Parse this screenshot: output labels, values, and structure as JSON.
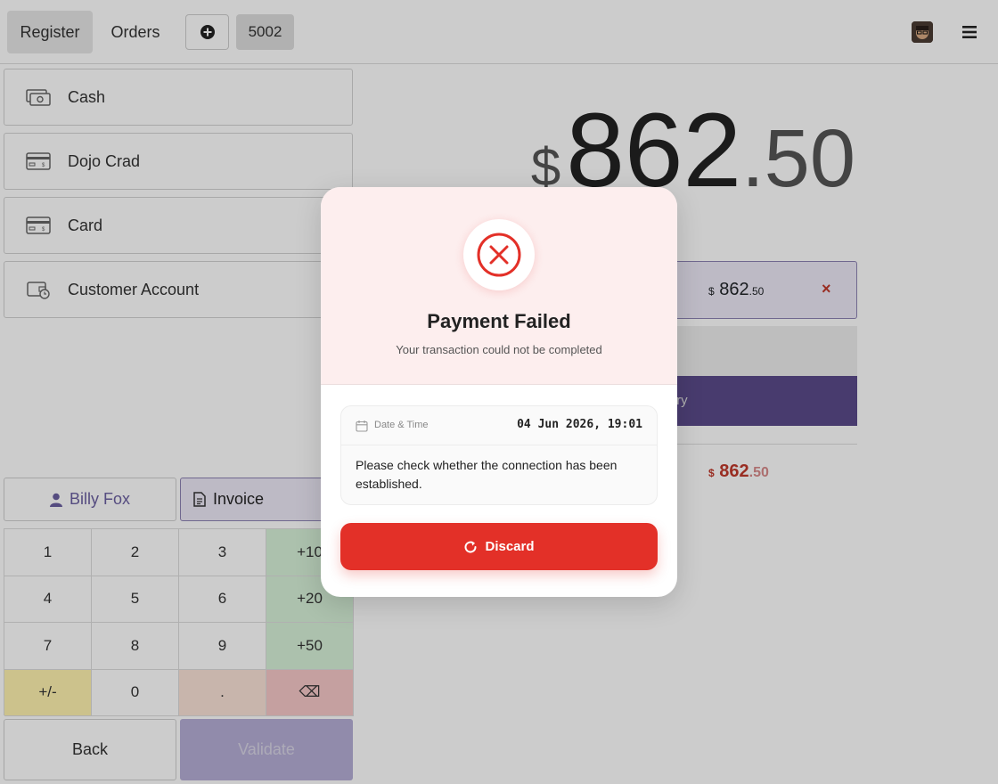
{
  "topbar": {
    "register_label": "Register",
    "orders_label": "Orders",
    "order_number": "5002"
  },
  "payment_methods": [
    {
      "label": "Cash",
      "icon": "cash-icon"
    },
    {
      "label": "Dojo Crad",
      "icon": "card-icon"
    },
    {
      "label": "Card",
      "icon": "card-icon"
    },
    {
      "label": "Customer Account",
      "icon": "wallet-clock-icon"
    }
  ],
  "total": {
    "currency": "$",
    "integer": "862",
    "decimal": ".50"
  },
  "payment_line": {
    "currency": "$",
    "integer": "862",
    "decimal": ".50",
    "remove_symbol": "×"
  },
  "retry_label_fragment": "try",
  "remaining": {
    "currency": "$",
    "integer": "862",
    "decimal": ".50"
  },
  "customer": {
    "name": "Billy Fox"
  },
  "invoice": {
    "label": "Invoice"
  },
  "numpad": {
    "keys": [
      "1",
      "2",
      "3",
      "+10",
      "4",
      "5",
      "6",
      "+20",
      "7",
      "8",
      "9",
      "+50",
      "+/-",
      "0",
      ".",
      "⌫"
    ]
  },
  "footer": {
    "back_label": "Back",
    "validate_label": "Validate"
  },
  "modal": {
    "title": "Payment Failed",
    "subtitle": "Your transaction could not be completed",
    "date_label": "Date & Time",
    "date_value": "04 Jun 2026, 19:01",
    "message": "Please check whether the connection has been established.",
    "discard_label": "Discard"
  },
  "colors": {
    "accent": "#6b5fa0",
    "error": "#e33028",
    "modal_header": "#fdeeee"
  }
}
